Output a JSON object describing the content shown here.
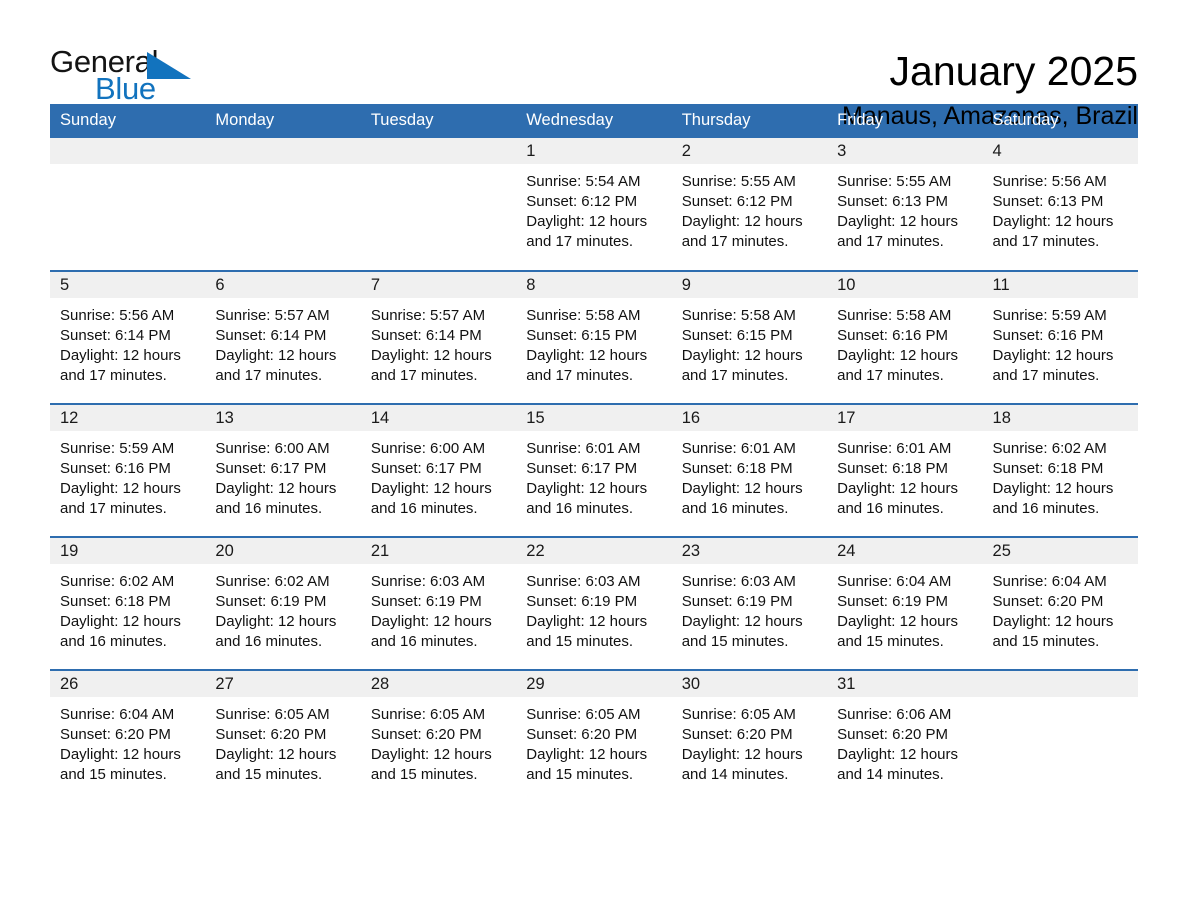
{
  "logo": {
    "word1": "General",
    "word2": "Blue",
    "triangle_icon": "triangle-icon",
    "blue": "#1273BE"
  },
  "header": {
    "month_title": "January 2025",
    "location": "Manaus, Amazonas, Brazil"
  },
  "theme": {
    "header_blue": "#2E6DAF",
    "daynum_gray": "#F0F0F0",
    "page_background": "#FFFFFF"
  },
  "day_headers": [
    "Sunday",
    "Monday",
    "Tuesday",
    "Wednesday",
    "Thursday",
    "Friday",
    "Saturday"
  ],
  "weeks": [
    [
      {
        "day": "",
        "sunrise": "",
        "sunset": "",
        "daylight": ""
      },
      {
        "day": "",
        "sunrise": "",
        "sunset": "",
        "daylight": ""
      },
      {
        "day": "",
        "sunrise": "",
        "sunset": "",
        "daylight": ""
      },
      {
        "day": "1",
        "sunrise": "Sunrise: 5:54 AM",
        "sunset": "Sunset: 6:12 PM",
        "daylight": "Daylight: 12 hours and 17 minutes."
      },
      {
        "day": "2",
        "sunrise": "Sunrise: 5:55 AM",
        "sunset": "Sunset: 6:12 PM",
        "daylight": "Daylight: 12 hours and 17 minutes."
      },
      {
        "day": "3",
        "sunrise": "Sunrise: 5:55 AM",
        "sunset": "Sunset: 6:13 PM",
        "daylight": "Daylight: 12 hours and 17 minutes."
      },
      {
        "day": "4",
        "sunrise": "Sunrise: 5:56 AM",
        "sunset": "Sunset: 6:13 PM",
        "daylight": "Daylight: 12 hours and 17 minutes."
      }
    ],
    [
      {
        "day": "5",
        "sunrise": "Sunrise: 5:56 AM",
        "sunset": "Sunset: 6:14 PM",
        "daylight": "Daylight: 12 hours and 17 minutes."
      },
      {
        "day": "6",
        "sunrise": "Sunrise: 5:57 AM",
        "sunset": "Sunset: 6:14 PM",
        "daylight": "Daylight: 12 hours and 17 minutes."
      },
      {
        "day": "7",
        "sunrise": "Sunrise: 5:57 AM",
        "sunset": "Sunset: 6:14 PM",
        "daylight": "Daylight: 12 hours and 17 minutes."
      },
      {
        "day": "8",
        "sunrise": "Sunrise: 5:58 AM",
        "sunset": "Sunset: 6:15 PM",
        "daylight": "Daylight: 12 hours and 17 minutes."
      },
      {
        "day": "9",
        "sunrise": "Sunrise: 5:58 AM",
        "sunset": "Sunset: 6:15 PM",
        "daylight": "Daylight: 12 hours and 17 minutes."
      },
      {
        "day": "10",
        "sunrise": "Sunrise: 5:58 AM",
        "sunset": "Sunset: 6:16 PM",
        "daylight": "Daylight: 12 hours and 17 minutes."
      },
      {
        "day": "11",
        "sunrise": "Sunrise: 5:59 AM",
        "sunset": "Sunset: 6:16 PM",
        "daylight": "Daylight: 12 hours and 17 minutes."
      }
    ],
    [
      {
        "day": "12",
        "sunrise": "Sunrise: 5:59 AM",
        "sunset": "Sunset: 6:16 PM",
        "daylight": "Daylight: 12 hours and 17 minutes."
      },
      {
        "day": "13",
        "sunrise": "Sunrise: 6:00 AM",
        "sunset": "Sunset: 6:17 PM",
        "daylight": "Daylight: 12 hours and 16 minutes."
      },
      {
        "day": "14",
        "sunrise": "Sunrise: 6:00 AM",
        "sunset": "Sunset: 6:17 PM",
        "daylight": "Daylight: 12 hours and 16 minutes."
      },
      {
        "day": "15",
        "sunrise": "Sunrise: 6:01 AM",
        "sunset": "Sunset: 6:17 PM",
        "daylight": "Daylight: 12 hours and 16 minutes."
      },
      {
        "day": "16",
        "sunrise": "Sunrise: 6:01 AM",
        "sunset": "Sunset: 6:18 PM",
        "daylight": "Daylight: 12 hours and 16 minutes."
      },
      {
        "day": "17",
        "sunrise": "Sunrise: 6:01 AM",
        "sunset": "Sunset: 6:18 PM",
        "daylight": "Daylight: 12 hours and 16 minutes."
      },
      {
        "day": "18",
        "sunrise": "Sunrise: 6:02 AM",
        "sunset": "Sunset: 6:18 PM",
        "daylight": "Daylight: 12 hours and 16 minutes."
      }
    ],
    [
      {
        "day": "19",
        "sunrise": "Sunrise: 6:02 AM",
        "sunset": "Sunset: 6:18 PM",
        "daylight": "Daylight: 12 hours and 16 minutes."
      },
      {
        "day": "20",
        "sunrise": "Sunrise: 6:02 AM",
        "sunset": "Sunset: 6:19 PM",
        "daylight": "Daylight: 12 hours and 16 minutes."
      },
      {
        "day": "21",
        "sunrise": "Sunrise: 6:03 AM",
        "sunset": "Sunset: 6:19 PM",
        "daylight": "Daylight: 12 hours and 16 minutes."
      },
      {
        "day": "22",
        "sunrise": "Sunrise: 6:03 AM",
        "sunset": "Sunset: 6:19 PM",
        "daylight": "Daylight: 12 hours and 15 minutes."
      },
      {
        "day": "23",
        "sunrise": "Sunrise: 6:03 AM",
        "sunset": "Sunset: 6:19 PM",
        "daylight": "Daylight: 12 hours and 15 minutes."
      },
      {
        "day": "24",
        "sunrise": "Sunrise: 6:04 AM",
        "sunset": "Sunset: 6:19 PM",
        "daylight": "Daylight: 12 hours and 15 minutes."
      },
      {
        "day": "25",
        "sunrise": "Sunrise: 6:04 AM",
        "sunset": "Sunset: 6:20 PM",
        "daylight": "Daylight: 12 hours and 15 minutes."
      }
    ],
    [
      {
        "day": "26",
        "sunrise": "Sunrise: 6:04 AM",
        "sunset": "Sunset: 6:20 PM",
        "daylight": "Daylight: 12 hours and 15 minutes."
      },
      {
        "day": "27",
        "sunrise": "Sunrise: 6:05 AM",
        "sunset": "Sunset: 6:20 PM",
        "daylight": "Daylight: 12 hours and 15 minutes."
      },
      {
        "day": "28",
        "sunrise": "Sunrise: 6:05 AM",
        "sunset": "Sunset: 6:20 PM",
        "daylight": "Daylight: 12 hours and 15 minutes."
      },
      {
        "day": "29",
        "sunrise": "Sunrise: 6:05 AM",
        "sunset": "Sunset: 6:20 PM",
        "daylight": "Daylight: 12 hours and 15 minutes."
      },
      {
        "day": "30",
        "sunrise": "Sunrise: 6:05 AM",
        "sunset": "Sunset: 6:20 PM",
        "daylight": "Daylight: 12 hours and 14 minutes."
      },
      {
        "day": "31",
        "sunrise": "Sunrise: 6:06 AM",
        "sunset": "Sunset: 6:20 PM",
        "daylight": "Daylight: 12 hours and 14 minutes."
      },
      {
        "day": "",
        "sunrise": "",
        "sunset": "",
        "daylight": ""
      }
    ]
  ]
}
